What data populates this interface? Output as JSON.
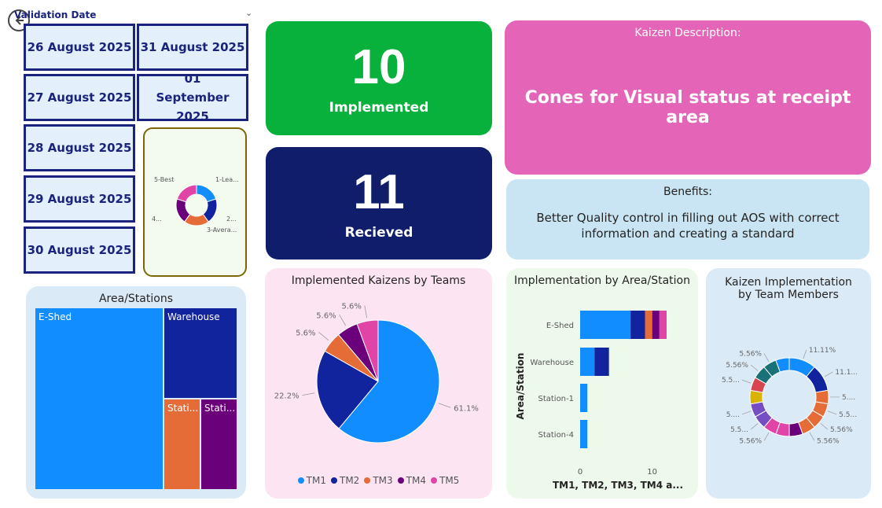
{
  "slicer": {
    "title": "Validation Date",
    "dates": [
      "26 August 2025",
      "31 August 2025",
      "27 August 2025",
      "01 September 2025",
      "28 August 2025",
      "29 August 2025",
      "30 August 2025"
    ]
  },
  "small_donut": {
    "labels": [
      "5-Best",
      "1-Lea...",
      "2...",
      "3-Avera...",
      "4..."
    ],
    "colors": [
      "#e044a7",
      "#118dff",
      "#12239e",
      "#e66c37",
      "#6b007b"
    ]
  },
  "kpi": {
    "implemented": {
      "value": "10",
      "label": "Implemented",
      "color": "#08b13b"
    },
    "received": {
      "value": "11",
      "label": "Recieved",
      "color": "#0f1d6b"
    }
  },
  "kaizen": {
    "title": "Kaizen Description:",
    "value": "Cones for Visual status at receipt area"
  },
  "benefits": {
    "title": "Benefits:",
    "value": "Better Quality control in filling out AOS with correct information and creating a standard"
  },
  "treemap": {
    "title": "Area/Stations",
    "cells": [
      "E-Shed",
      "Warehouse",
      "Stati...",
      "Stati..."
    ]
  },
  "colors": {
    "tm1": "#118dff",
    "tm2": "#12239e",
    "tm3": "#e66c37",
    "tm4": "#6b007b",
    "tm5": "#e044a7"
  },
  "chart_data": [
    {
      "type": "pie",
      "title": "Implemented Kaizens by Teams",
      "categories": [
        "TM1",
        "TM2",
        "TM3",
        "TM4",
        "TM5"
      ],
      "values": [
        61.1,
        22.2,
        5.6,
        5.6,
        5.6
      ],
      "labels": [
        "61.1%",
        "22.2%",
        "5.6%",
        "5.6%",
        "5.6%"
      ],
      "legend": "bottom"
    },
    {
      "type": "bar",
      "orientation": "horizontal",
      "stacked": true,
      "title": "Implementation by Area/Station",
      "categories": [
        "E-Shed",
        "Warehouse",
        "Station-1",
        "Station-4"
      ],
      "series": [
        {
          "name": "TM1",
          "values": [
            7,
            2,
            1,
            1
          ]
        },
        {
          "name": "TM2",
          "values": [
            2,
            2,
            0,
            0
          ]
        },
        {
          "name": "TM3",
          "values": [
            1,
            0,
            0,
            0
          ]
        },
        {
          "name": "TM4",
          "values": [
            1,
            0,
            0,
            0
          ]
        },
        {
          "name": "TM5",
          "values": [
            1,
            0,
            0,
            0
          ]
        }
      ],
      "xlabel": "TM1, TM2, TM3, TM4 a...",
      "ylabel": "Area/Station",
      "xticks": [
        "0",
        "10"
      ],
      "xlim": [
        0,
        12
      ]
    },
    {
      "type": "pie",
      "donut": true,
      "title": "Kaizen Implementation by Team Members",
      "values": [
        11.11,
        11.11,
        5.56,
        5.56,
        5.56,
        5.56,
        5.56,
        5.56,
        5.56,
        5.56,
        5.56,
        5.56,
        5.56,
        5.56,
        5.56,
        5.56
      ],
      "labels": [
        "11.11%",
        "11.1...",
        "5....",
        "5.5...",
        "5.56%",
        "5.56%",
        "",
        "",
        "5.56%",
        "5.5...",
        "5....",
        "",
        "5.5...",
        "5.56%",
        "5.56%",
        ""
      ],
      "colors": [
        "#118dff",
        "#12239e",
        "#e66c37",
        "#e66c37",
        "#e66c37",
        "#e66c37",
        "#6b007b",
        "#e044a7",
        "#e044a7",
        "#744ec2",
        "#744ec2",
        "#d9b300",
        "#d64550",
        "#197278",
        "#197278",
        "#118dff"
      ]
    }
  ]
}
